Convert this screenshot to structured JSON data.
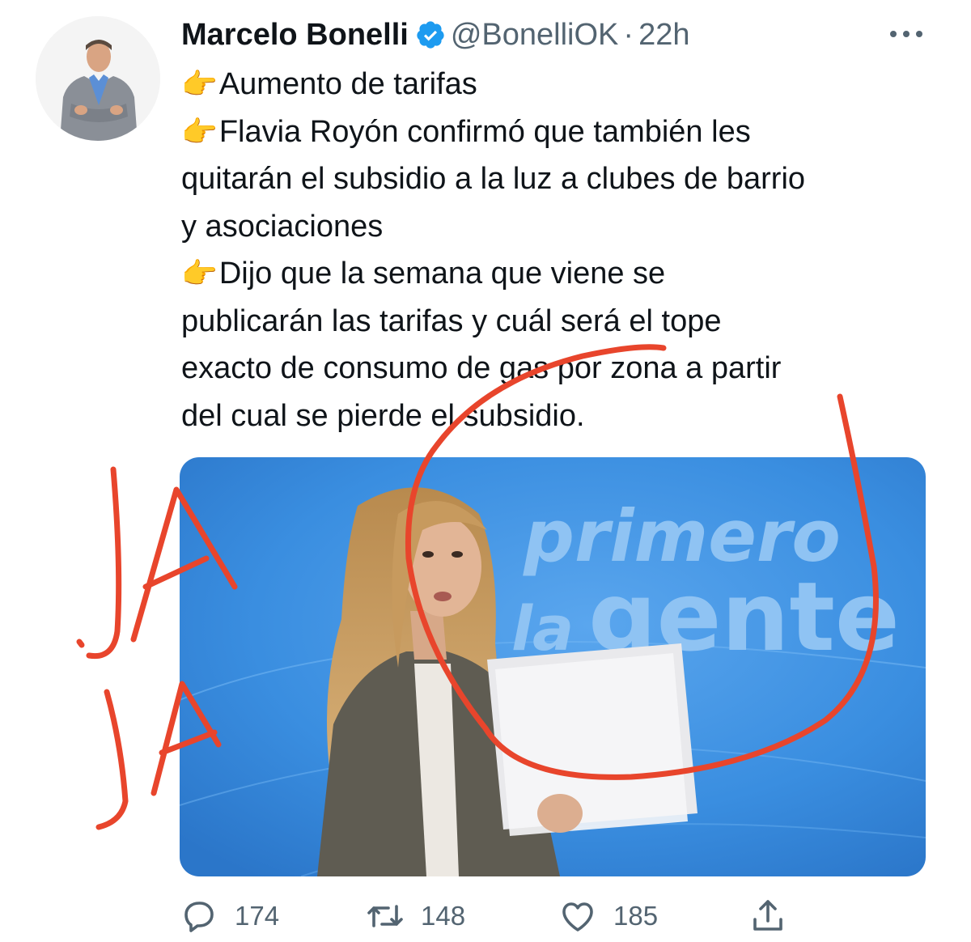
{
  "author": {
    "display_name": "Marcelo Bonelli",
    "handle": "@BonelliOK",
    "separator": "·",
    "timestamp": "22h",
    "verified": true
  },
  "tweet_lines": [
    {
      "pointer": "👉",
      "text": "Aumento de tarifas"
    },
    {
      "pointer": "👉",
      "text": "Flavia Royón confirmó que también les"
    },
    {
      "pointer": "",
      "text": "quitarán el subsidio a la luz a clubes de barrio"
    },
    {
      "pointer": "",
      "text": "y asociaciones"
    },
    {
      "pointer": "👉",
      "text": "Dijo que la semana que viene se"
    },
    {
      "pointer": "",
      "text": "publicarán las tarifas y cuál será el tope"
    },
    {
      "pointer": "",
      "text": "exacto de consumo de gas por zona a partir"
    },
    {
      "pointer": "",
      "text": "del cual se pierde el subsidio."
    }
  ],
  "media": {
    "backdrop_line1": "primero",
    "backdrop_line2_a": "la",
    "backdrop_line2_b": "gente"
  },
  "annotation": {
    "handwriting": "JA JA",
    "color": "#e8452c"
  },
  "actions": {
    "reply_count": "174",
    "retweet_count": "148",
    "like_count": "185"
  },
  "colors": {
    "text": "#0f1419",
    "secondary": "#536471",
    "verified": "#1d9bf0",
    "media_blue": "#3a8ee0"
  }
}
